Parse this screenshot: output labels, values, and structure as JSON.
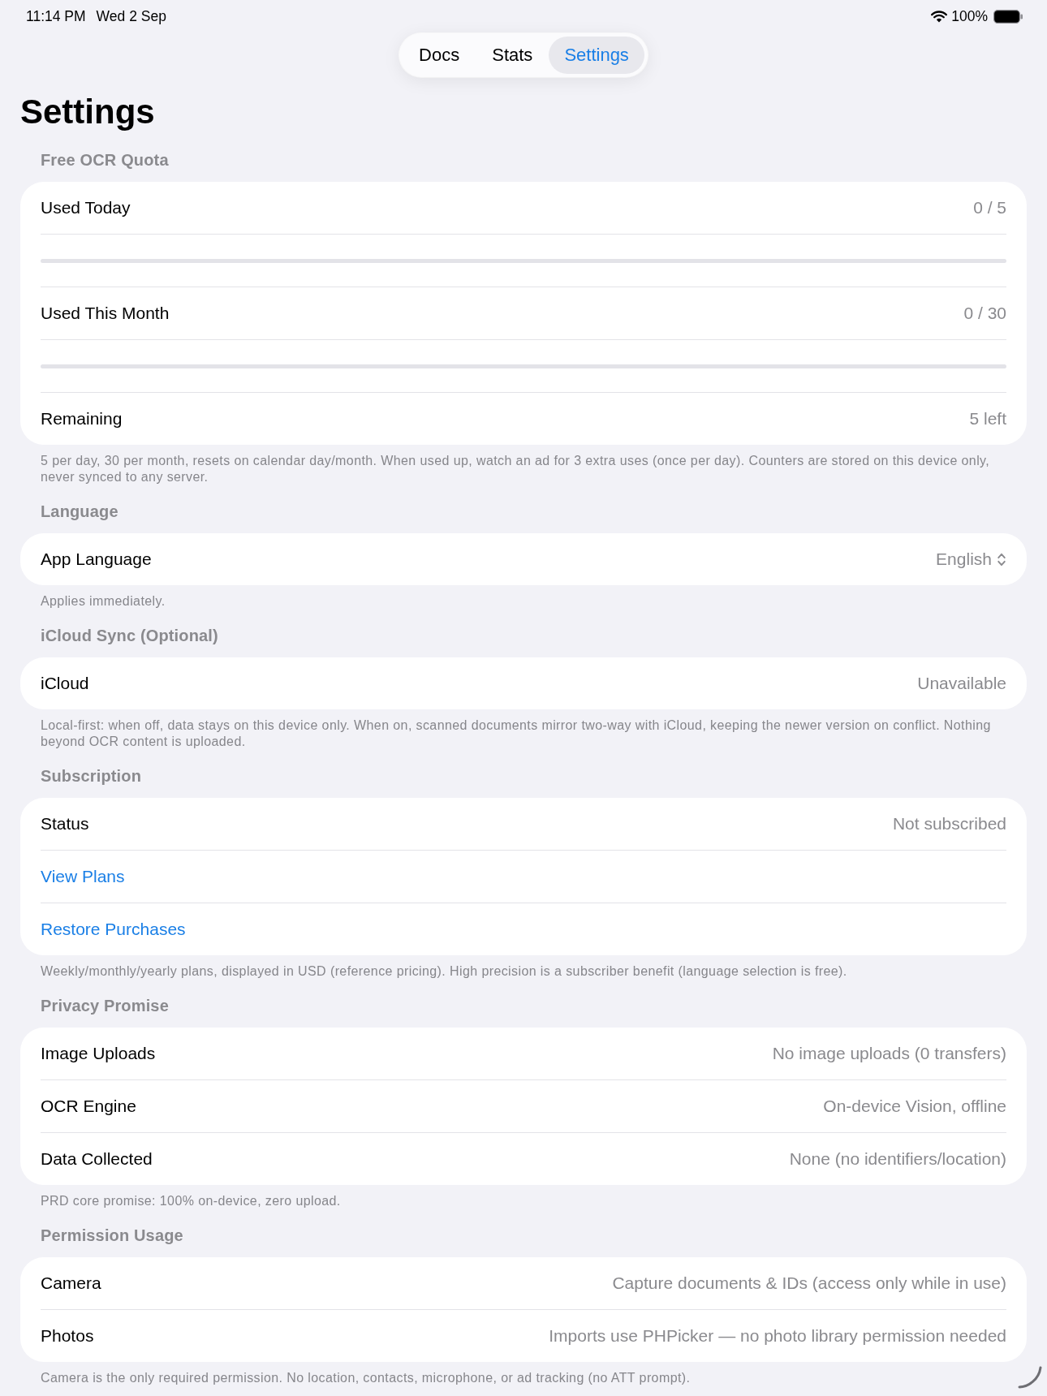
{
  "status_bar": {
    "time": "11:14 PM",
    "date": "Wed 2 Sep",
    "battery": "100%"
  },
  "tabs": [
    {
      "label": "Docs",
      "selected": false
    },
    {
      "label": "Stats",
      "selected": false
    },
    {
      "label": "Settings",
      "selected": true
    }
  ],
  "title": "Settings",
  "sections": [
    {
      "header": "Free OCR Quota",
      "rows": [
        {
          "kind": "value",
          "label": "Used Today",
          "value": "0 / 5"
        },
        {
          "kind": "progress",
          "level": 0
        },
        {
          "kind": "value",
          "label": "Used This Month",
          "value": "0 / 30"
        },
        {
          "kind": "progress",
          "level": 0
        },
        {
          "kind": "value",
          "label": "Remaining",
          "value": "5 left"
        }
      ],
      "footer": "5 per day, 30 per month, resets on calendar day/month. When used up, watch an ad for 3 extra uses (once per day). Counters are stored on this device only, never synced to any server."
    },
    {
      "header": "Language",
      "rows": [
        {
          "kind": "picker",
          "label": "App Language",
          "value": "English"
        }
      ],
      "footer": "Applies immediately."
    },
    {
      "header": "iCloud Sync (Optional)",
      "rows": [
        {
          "kind": "value",
          "label": "iCloud",
          "value": "Unavailable"
        }
      ],
      "footer": "Local-first: when off, data stays on this device only. When on, scanned documents mirror two-way with iCloud, keeping the newer version on conflict. Nothing beyond OCR content is uploaded."
    },
    {
      "header": "Subscription",
      "rows": [
        {
          "kind": "value",
          "label": "Status",
          "value": "Not subscribed"
        },
        {
          "kind": "link",
          "label": "View Plans"
        },
        {
          "kind": "link",
          "label": "Restore Purchases"
        }
      ],
      "footer": "Weekly/monthly/yearly plans, displayed in USD (reference pricing). High precision is a subscriber benefit (language selection is free)."
    },
    {
      "header": "Privacy Promise",
      "rows": [
        {
          "kind": "value",
          "label": "Image Uploads",
          "value": "No image uploads (0 transfers)"
        },
        {
          "kind": "value",
          "label": "OCR Engine",
          "value": "On-device Vision, offline"
        },
        {
          "kind": "value",
          "label": "Data Collected",
          "value": "None (no identifiers/location)"
        }
      ],
      "footer": "PRD core promise: 100% on-device, zero upload."
    },
    {
      "header": "Permission Usage",
      "rows": [
        {
          "kind": "value",
          "label": "Camera",
          "value": "Capture documents & IDs (access only while in use)"
        },
        {
          "kind": "value",
          "label": "Photos",
          "value": "Imports use PHPicker — no photo library permission needed"
        }
      ],
      "footer": "Camera is the only required permission. No location, contacts, microphone, or ad tracking (no ATT prompt)."
    }
  ]
}
